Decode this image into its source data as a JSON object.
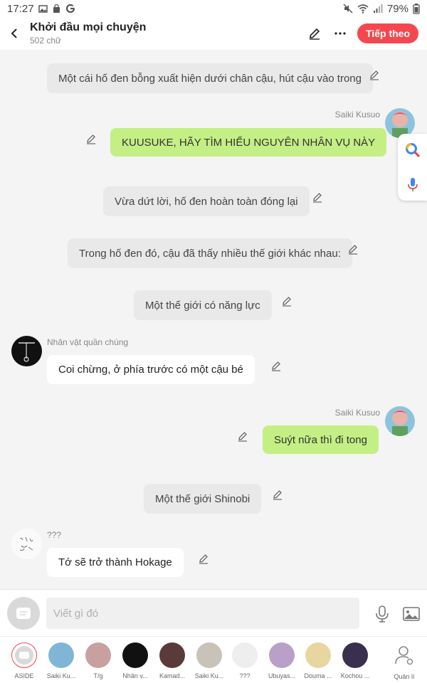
{
  "status_bar": {
    "time": "17:27",
    "battery": "79%",
    "left_icons": [
      "image-icon",
      "bag-icon",
      "google-icon"
    ],
    "right_icons": [
      "mute-icon",
      "wifi-icon",
      "signal-icon",
      "battery-icon"
    ]
  },
  "header": {
    "title": "Khởi đầu mọi chuyện",
    "subtitle": "502 chữ",
    "follow_label": "Tiếp theo"
  },
  "messages": [
    {
      "type": "narration",
      "text": "Một cái hố đen bỗng xuất hiện dưới chân cậu, hút cậu vào trong"
    },
    {
      "type": "me",
      "sender": "Saiki Kusuo",
      "text": "KUUSUKE, HÃY TÌM HIỂU NGUYÊN NHÂN VỤ NÀY"
    },
    {
      "type": "narration",
      "text": "Vừa dứt lời, hố đen hoàn toàn đóng lại"
    },
    {
      "type": "narration",
      "text": "Trong hố đen đó, cậu đã thấy nhiều thế giới khác nhau:"
    },
    {
      "type": "narration",
      "text": "Một thế giới có năng lực"
    },
    {
      "type": "other",
      "sender": "Nhân vật quần chúng",
      "text": "Coi chừng, ở phía trước có một cậu bé"
    },
    {
      "type": "me",
      "sender": "Saiki Kusuo",
      "text": "Suýt nữa thì đi tong"
    },
    {
      "type": "narration",
      "text": "Một thế giới Shinobi"
    },
    {
      "type": "other",
      "sender": "???",
      "text": "Tớ sẽ trở thành Hokage"
    }
  ],
  "input": {
    "placeholder": "Viết gì đó"
  },
  "characters": [
    {
      "label": "ASIDE",
      "color": "#d9d9d9"
    },
    {
      "label": "Saiki Ku...",
      "color": "#7fb6d6"
    },
    {
      "label": "T/g",
      "color": "#c9a0a0"
    },
    {
      "label": "Nhân v...",
      "color": "#111111"
    },
    {
      "label": "Kamad...",
      "color": "#5a3a3a"
    },
    {
      "label": "Saiki Ku...",
      "color": "#c8c2b8"
    },
    {
      "label": "???",
      "color": "#eeeeee"
    },
    {
      "label": "Ubuyas...",
      "color": "#b9a0c8"
    },
    {
      "label": "Douma ...",
      "color": "#e8d6a0"
    },
    {
      "label": "Kochou ...",
      "color": "#3b2f50"
    }
  ],
  "manage_label": "Quản lí",
  "colors": {
    "accent": "#f5474e",
    "me_bubble": "#c4ef84",
    "narration_bubble": "#e9e9e9"
  }
}
